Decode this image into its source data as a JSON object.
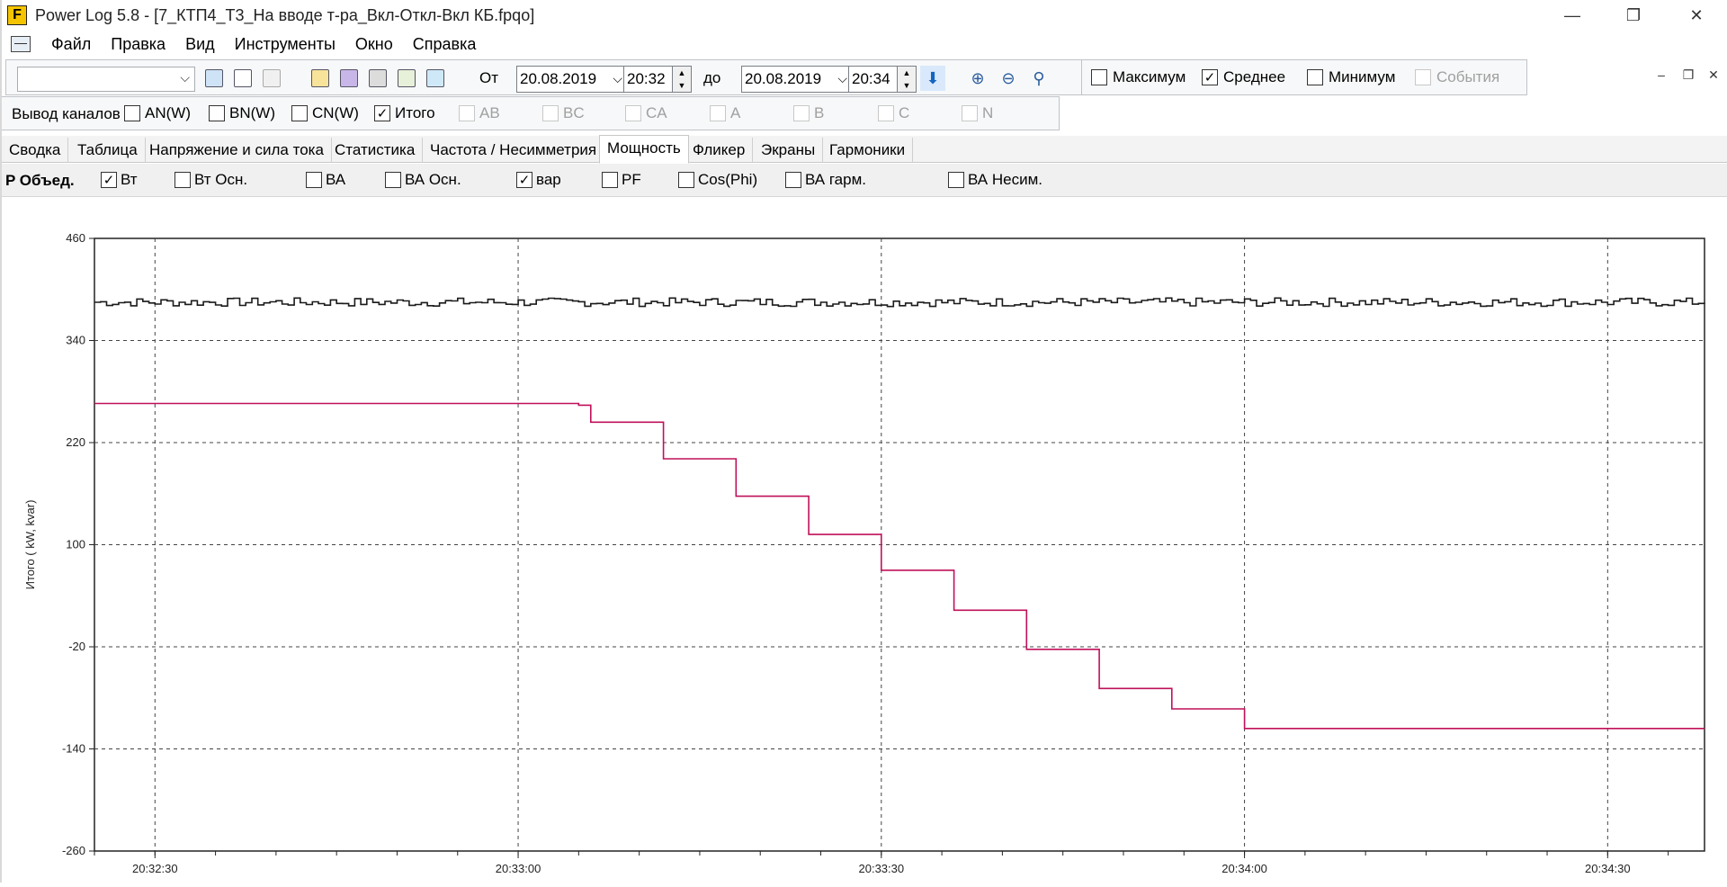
{
  "window": {
    "app_title": "Power Log 5.8 - [7_КТП4_Т3_На вводе т-ра_Вкл-Откл-Вкл КБ.fpqo]",
    "logo_letter": "F",
    "minimize": "—",
    "maximize": "❐",
    "close": "✕",
    "mdi_minimize": "–",
    "mdi_restore": "❐",
    "mdi_close": "✕"
  },
  "menu": [
    "Файл",
    "Правка",
    "Вид",
    "Инструменты",
    "Окно",
    "Справка"
  ],
  "toolbar": {
    "from_label": "От",
    "from_date": "20.08.2019",
    "from_time": "20:32",
    "to_label": "до",
    "to_date": "20.08.2019",
    "to_time": "20:34",
    "show_checks": [
      {
        "label": "Максимум",
        "checked": false,
        "disabled": false
      },
      {
        "label": "Среднее",
        "checked": true,
        "disabled": false
      },
      {
        "label": "Минимум",
        "checked": false,
        "disabled": false
      },
      {
        "label": "События",
        "checked": false,
        "disabled": true
      }
    ]
  },
  "channels": {
    "label": "Вывод каналов",
    "items": [
      {
        "label": "AN(W)",
        "checked": false,
        "disabled": false
      },
      {
        "label": "BN(W)",
        "checked": false,
        "disabled": false
      },
      {
        "label": "CN(W)",
        "checked": false,
        "disabled": false
      },
      {
        "label": "Итого",
        "checked": true,
        "disabled": false
      },
      {
        "label": "AB",
        "checked": false,
        "disabled": true
      },
      {
        "label": "BC",
        "checked": false,
        "disabled": true
      },
      {
        "label": "CA",
        "checked": false,
        "disabled": true
      },
      {
        "label": "A",
        "checked": false,
        "disabled": true
      },
      {
        "label": "B",
        "checked": false,
        "disabled": true
      },
      {
        "label": "C",
        "checked": false,
        "disabled": true
      },
      {
        "label": "N",
        "checked": false,
        "disabled": true
      }
    ]
  },
  "tabs": [
    {
      "label": "Сводка",
      "active": false
    },
    {
      "label": "Таблица",
      "active": false
    },
    {
      "label": "Напряжение и сила тока",
      "active": false
    },
    {
      "label": "Статистика",
      "active": false
    },
    {
      "label": "Частота / Несимметрия",
      "active": false
    },
    {
      "label": "Мощность",
      "active": true
    },
    {
      "label": "Фликер",
      "active": false
    },
    {
      "label": "Экраны",
      "active": false
    },
    {
      "label": "Гармоники",
      "active": false
    }
  ],
  "power": {
    "label": "P Объед.",
    "items": [
      {
        "label": "Вт",
        "checked": true
      },
      {
        "label": "Вт Осн.",
        "checked": false
      },
      {
        "label": "ВА",
        "checked": false
      },
      {
        "label": "ВА Осн.",
        "checked": false
      },
      {
        "label": "вар",
        "checked": true
      },
      {
        "label": "PF",
        "checked": false
      },
      {
        "label": "Cos(Phi)",
        "checked": false
      },
      {
        "label": "ВА гарм.",
        "checked": false
      },
      {
        "label": "ВА Несим.",
        "checked": false
      }
    ]
  },
  "chart_data": {
    "type": "line",
    "ylabel": "Итого ( kW, kvar)",
    "xlabel": "",
    "ylim": [
      -260,
      460
    ],
    "yticks": [
      460,
      340,
      220,
      100,
      -20,
      -140,
      -260
    ],
    "xlim": [
      "20:32:25",
      "20:34:38"
    ],
    "xticks": [
      "20:32:30",
      "20:33:00",
      "20:33:30",
      "20:34:00",
      "20:34:30"
    ],
    "grid": true,
    "series": [
      {
        "color": "#1a1a1a",
        "description_level": "approx 385 with ±5 fluctuation",
        "x": [
          "20:32:25",
          "20:34:38"
        ],
        "values": [
          385,
          385
        ],
        "jitter": 5
      },
      {
        "color": "#c0105a",
        "x": [
          "20:32:25",
          "20:33:05",
          "20:33:06",
          "20:33:12",
          "20:33:18",
          "20:33:24",
          "20:33:30",
          "20:33:36",
          "20:33:42",
          "20:33:48",
          "20:33:54",
          "20:34:00",
          "20:34:06",
          "20:34:38"
        ],
        "values": [
          266,
          264,
          244,
          201,
          157,
          112,
          70,
          23,
          -23,
          -69,
          -93,
          -116,
          -116,
          -116
        ],
        "step": true
      }
    ]
  }
}
